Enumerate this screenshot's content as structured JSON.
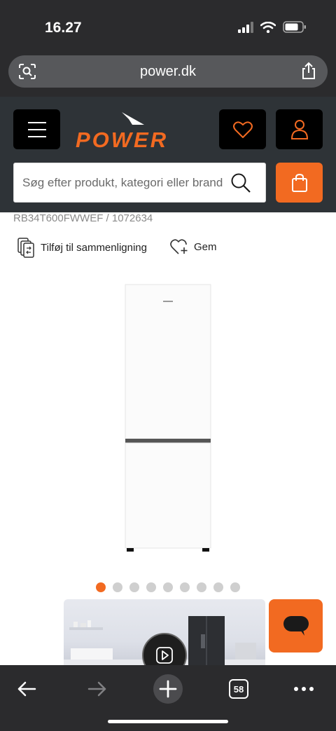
{
  "status": {
    "time": "16.27"
  },
  "browser": {
    "url": "power.dk",
    "tab_count": "58"
  },
  "header": {
    "logo_text": "POWER",
    "search_placeholder": "Søg efter produkt, kategori eller brand",
    "brand_color": "#f26a21"
  },
  "product": {
    "sku_line": "RB34T600FWWEF / 1072634",
    "compare_label": "Tilføj til sammenligning",
    "save_label": "Gem",
    "image_count": 9,
    "active_image": 1
  },
  "icons": [
    "signal-icon",
    "wifi-icon",
    "battery-icon",
    "lens-icon",
    "share-icon",
    "menu-icon",
    "heart-icon",
    "user-icon",
    "search-icon",
    "cart-icon",
    "compare-icon",
    "heart-plus-icon",
    "play-icon",
    "chat-icon",
    "back-arrow-icon",
    "forward-arrow-icon",
    "plus-icon",
    "more-icon"
  ]
}
